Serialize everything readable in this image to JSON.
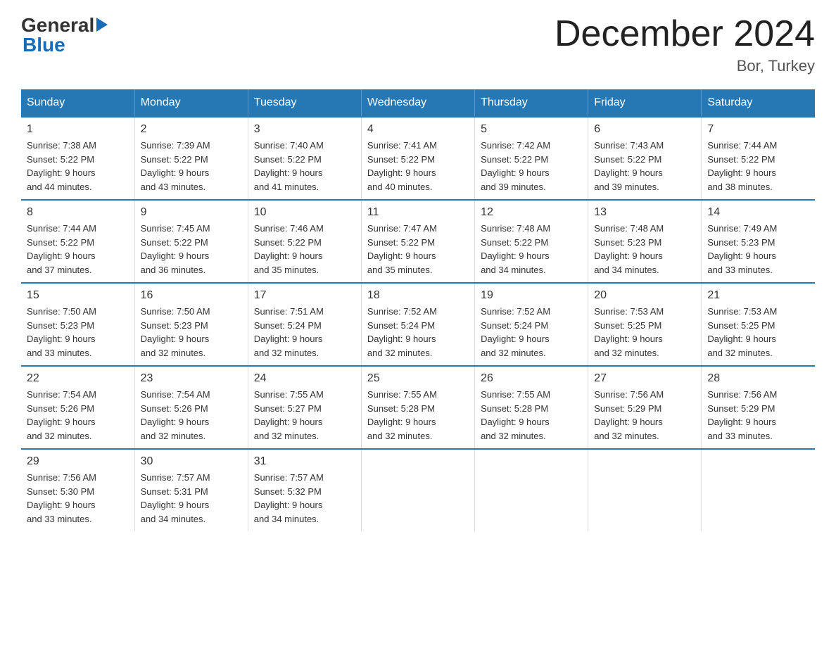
{
  "logo": {
    "general": "General",
    "arrow": "",
    "blue": "Blue"
  },
  "title": {
    "month_year": "December 2024",
    "location": "Bor, Turkey"
  },
  "weekdays": [
    "Sunday",
    "Monday",
    "Tuesday",
    "Wednesday",
    "Thursday",
    "Friday",
    "Saturday"
  ],
  "weeks": [
    [
      {
        "day": "1",
        "sunrise": "7:38 AM",
        "sunset": "5:22 PM",
        "daylight": "9 hours and 44 minutes."
      },
      {
        "day": "2",
        "sunrise": "7:39 AM",
        "sunset": "5:22 PM",
        "daylight": "9 hours and 43 minutes."
      },
      {
        "day": "3",
        "sunrise": "7:40 AM",
        "sunset": "5:22 PM",
        "daylight": "9 hours and 41 minutes."
      },
      {
        "day": "4",
        "sunrise": "7:41 AM",
        "sunset": "5:22 PM",
        "daylight": "9 hours and 40 minutes."
      },
      {
        "day": "5",
        "sunrise": "7:42 AM",
        "sunset": "5:22 PM",
        "daylight": "9 hours and 39 minutes."
      },
      {
        "day": "6",
        "sunrise": "7:43 AM",
        "sunset": "5:22 PM",
        "daylight": "9 hours and 39 minutes."
      },
      {
        "day": "7",
        "sunrise": "7:44 AM",
        "sunset": "5:22 PM",
        "daylight": "9 hours and 38 minutes."
      }
    ],
    [
      {
        "day": "8",
        "sunrise": "7:44 AM",
        "sunset": "5:22 PM",
        "daylight": "9 hours and 37 minutes."
      },
      {
        "day": "9",
        "sunrise": "7:45 AM",
        "sunset": "5:22 PM",
        "daylight": "9 hours and 36 minutes."
      },
      {
        "day": "10",
        "sunrise": "7:46 AM",
        "sunset": "5:22 PM",
        "daylight": "9 hours and 35 minutes."
      },
      {
        "day": "11",
        "sunrise": "7:47 AM",
        "sunset": "5:22 PM",
        "daylight": "9 hours and 35 minutes."
      },
      {
        "day": "12",
        "sunrise": "7:48 AM",
        "sunset": "5:22 PM",
        "daylight": "9 hours and 34 minutes."
      },
      {
        "day": "13",
        "sunrise": "7:48 AM",
        "sunset": "5:23 PM",
        "daylight": "9 hours and 34 minutes."
      },
      {
        "day": "14",
        "sunrise": "7:49 AM",
        "sunset": "5:23 PM",
        "daylight": "9 hours and 33 minutes."
      }
    ],
    [
      {
        "day": "15",
        "sunrise": "7:50 AM",
        "sunset": "5:23 PM",
        "daylight": "9 hours and 33 minutes."
      },
      {
        "day": "16",
        "sunrise": "7:50 AM",
        "sunset": "5:23 PM",
        "daylight": "9 hours and 32 minutes."
      },
      {
        "day": "17",
        "sunrise": "7:51 AM",
        "sunset": "5:24 PM",
        "daylight": "9 hours and 32 minutes."
      },
      {
        "day": "18",
        "sunrise": "7:52 AM",
        "sunset": "5:24 PM",
        "daylight": "9 hours and 32 minutes."
      },
      {
        "day": "19",
        "sunrise": "7:52 AM",
        "sunset": "5:24 PM",
        "daylight": "9 hours and 32 minutes."
      },
      {
        "day": "20",
        "sunrise": "7:53 AM",
        "sunset": "5:25 PM",
        "daylight": "9 hours and 32 minutes."
      },
      {
        "day": "21",
        "sunrise": "7:53 AM",
        "sunset": "5:25 PM",
        "daylight": "9 hours and 32 minutes."
      }
    ],
    [
      {
        "day": "22",
        "sunrise": "7:54 AM",
        "sunset": "5:26 PM",
        "daylight": "9 hours and 32 minutes."
      },
      {
        "day": "23",
        "sunrise": "7:54 AM",
        "sunset": "5:26 PM",
        "daylight": "9 hours and 32 minutes."
      },
      {
        "day": "24",
        "sunrise": "7:55 AM",
        "sunset": "5:27 PM",
        "daylight": "9 hours and 32 minutes."
      },
      {
        "day": "25",
        "sunrise": "7:55 AM",
        "sunset": "5:28 PM",
        "daylight": "9 hours and 32 minutes."
      },
      {
        "day": "26",
        "sunrise": "7:55 AM",
        "sunset": "5:28 PM",
        "daylight": "9 hours and 32 minutes."
      },
      {
        "day": "27",
        "sunrise": "7:56 AM",
        "sunset": "5:29 PM",
        "daylight": "9 hours and 32 minutes."
      },
      {
        "day": "28",
        "sunrise": "7:56 AM",
        "sunset": "5:29 PM",
        "daylight": "9 hours and 33 minutes."
      }
    ],
    [
      {
        "day": "29",
        "sunrise": "7:56 AM",
        "sunset": "5:30 PM",
        "daylight": "9 hours and 33 minutes."
      },
      {
        "day": "30",
        "sunrise": "7:57 AM",
        "sunset": "5:31 PM",
        "daylight": "9 hours and 34 minutes."
      },
      {
        "day": "31",
        "sunrise": "7:57 AM",
        "sunset": "5:32 PM",
        "daylight": "9 hours and 34 minutes."
      },
      null,
      null,
      null,
      null
    ]
  ],
  "labels": {
    "sunrise": "Sunrise:",
    "sunset": "Sunset:",
    "daylight": "Daylight:"
  }
}
